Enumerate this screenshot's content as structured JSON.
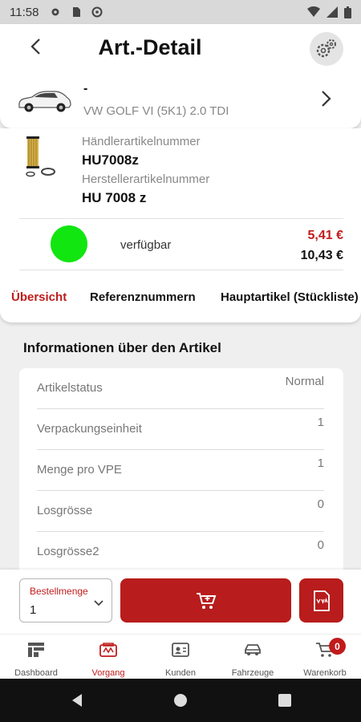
{
  "status_bar": {
    "time": "11:58"
  },
  "header": {
    "title": "Art.-Detail"
  },
  "vehicle": {
    "name_line": "-",
    "model": "VW GOLF VI (5K1) 2.0 TDI"
  },
  "article": {
    "dealer_number_label": "Händlerartikelnummer",
    "dealer_number": "HU7008z",
    "manufacturer_number_label": "Herstellerartikelnummer",
    "manufacturer_number": "HU 7008 z",
    "availability": "verfügbar",
    "availability_color": "#11e611",
    "price_net": "5,41 €",
    "price_gross": "10,43 €"
  },
  "tabs": [
    {
      "label": "Übersicht",
      "active": true
    },
    {
      "label": "Referenznummern",
      "active": false
    },
    {
      "label": "Hauptartikel (Stückliste)",
      "active": false
    }
  ],
  "info": {
    "title": "Informationen über den Artikel",
    "rows": [
      {
        "key": "Artikelstatus",
        "value": "Normal"
      },
      {
        "key": "Verpackungseinheit",
        "value": "1"
      },
      {
        "key": "Menge pro VPE",
        "value": "1"
      },
      {
        "key": "Losgrösse",
        "value": "0"
      },
      {
        "key": "Losgrösse2",
        "value": "0"
      }
    ]
  },
  "order": {
    "quantity_label": "Bestellmenge",
    "quantity_value": "1",
    "cart_icon": "cart-plus-icon",
    "kva_icon": "kva-document-icon"
  },
  "bottom_nav": [
    {
      "label": "Dashboard",
      "icon": "dashboard-icon",
      "active": false
    },
    {
      "label": "Vorgang",
      "icon": "process-icon",
      "active": true
    },
    {
      "label": "Kunden",
      "icon": "customers-icon",
      "active": false
    },
    {
      "label": "Fahrzeuge",
      "icon": "vehicles-icon",
      "active": false
    },
    {
      "label": "Warenkorb",
      "icon": "cart-icon",
      "active": false,
      "badge": "0"
    }
  ],
  "colors": {
    "accent": "#b81c1c",
    "accent_text": "#c11b1b",
    "background": "#efefef"
  }
}
